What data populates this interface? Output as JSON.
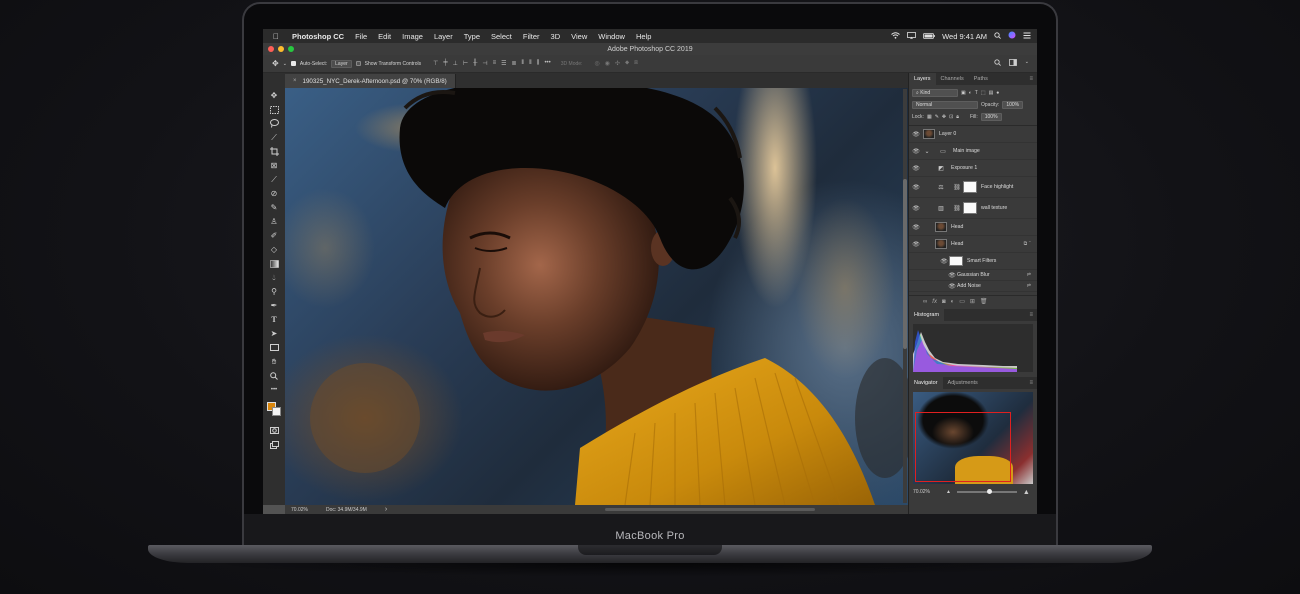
{
  "device": {
    "label": "MacBook Pro"
  },
  "menubar": {
    "apple": "",
    "app_name": "Photoshop CC",
    "items": [
      "File",
      "Edit",
      "Image",
      "Layer",
      "Type",
      "Select",
      "Filter",
      "3D",
      "View",
      "Window",
      "Help"
    ],
    "clock": "Wed 9:41 AM"
  },
  "window": {
    "title": "Adobe Photoshop CC 2019"
  },
  "options_bar": {
    "auto_select_label": "Auto-Select:",
    "auto_select_value": "Layer",
    "transform_label": "Show Transform Controls",
    "mode_3d_label": "3D Mode:"
  },
  "document": {
    "tab_title": "190325_NYC_Derek-Afternoon.psd @ 70% (RGB/8)",
    "close_glyph": "×"
  },
  "status_bar": {
    "zoom": "70.02%",
    "doc_size": "Doc: 34.9M/34.9M",
    "arrow": "›"
  },
  "layers_panel": {
    "tabs": [
      "Layers",
      "Channels",
      "Paths"
    ],
    "kind_label": "Kind",
    "blend_mode": "Normal",
    "opacity_label": "Opacity:",
    "opacity_value": "100%",
    "lock_label": "Lock:",
    "fill_label": "Fill:",
    "fill_value": "100%",
    "layers": [
      {
        "name": "Layer 0"
      },
      {
        "name": "Main image"
      },
      {
        "name": "Exposure 1"
      },
      {
        "name": "Face highlight"
      },
      {
        "name": "wall texture"
      },
      {
        "name": "Head"
      },
      {
        "name": "Head"
      },
      {
        "name": "Smart Filters"
      },
      {
        "name": "Gaussian Blur"
      },
      {
        "name": "Add Noise"
      }
    ]
  },
  "histogram_panel": {
    "title": "Histogram"
  },
  "navigator_panel": {
    "tabs": [
      "Navigator",
      "Adjustments"
    ],
    "zoom": "70.02%"
  },
  "colors": {
    "foreground": "#d9860d",
    "background": "#f4f4f4",
    "navigator_frame": "#e02020"
  },
  "icons": {
    "tools": [
      "move-icon",
      "marquee-icon",
      "lasso-icon",
      "quick-select-icon",
      "crop-icon",
      "frame-icon",
      "eyedropper-icon",
      "healing-brush-icon",
      "brush-icon",
      "clone-stamp-icon",
      "history-brush-icon",
      "eraser-icon",
      "gradient-icon",
      "blur-icon",
      "dodge-icon",
      "pen-icon",
      "type-icon",
      "path-select-icon",
      "rectangle-icon",
      "hand-icon",
      "zoom-icon",
      "more-icon"
    ]
  }
}
